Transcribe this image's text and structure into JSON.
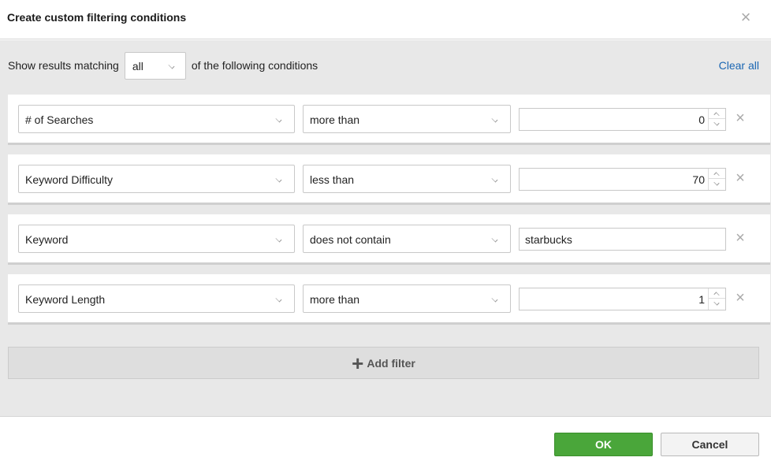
{
  "dialog": {
    "title": "Create custom filtering conditions",
    "close_icon": "close-icon"
  },
  "match": {
    "prefix": "Show results matching",
    "selected": "all",
    "suffix": "of the following conditions",
    "clear_all": "Clear all"
  },
  "filters": [
    {
      "field": "# of Searches",
      "operator": "more than",
      "value": "0",
      "value_type": "number"
    },
    {
      "field": "Keyword Difficulty",
      "operator": "less than",
      "value": "70",
      "value_type": "number"
    },
    {
      "field": "Keyword",
      "operator": "does not contain",
      "value": "starbucks",
      "value_type": "text"
    },
    {
      "field": "Keyword Length",
      "operator": "more than",
      "value": "1",
      "value_type": "number"
    }
  ],
  "add_filter": {
    "label": "Add filter",
    "icon": "plus-icon"
  },
  "footer": {
    "ok_label": "OK",
    "cancel_label": "Cancel"
  },
  "colors": {
    "ok": "#4aa63a",
    "link": "#1a66b3",
    "panel": "#e8e8e8"
  }
}
